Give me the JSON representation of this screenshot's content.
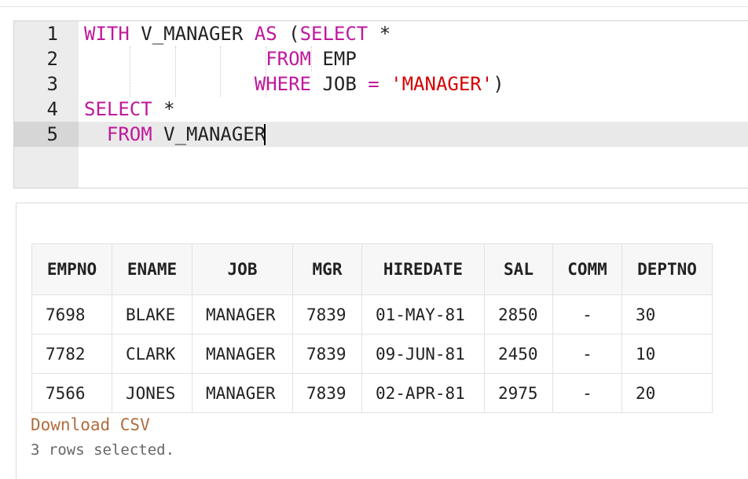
{
  "editor": {
    "line_numbers": [
      "1",
      "2",
      "3",
      "4",
      "5"
    ],
    "lines": [
      [
        {
          "t": "WITH",
          "c": "kw"
        },
        {
          "t": " V_MANAGER ",
          "c": ""
        },
        {
          "t": "AS",
          "c": "kw"
        },
        {
          "t": " (",
          "c": ""
        },
        {
          "t": "SELECT",
          "c": "kw"
        },
        {
          "t": " *",
          "c": ""
        }
      ],
      [
        {
          "t": "                ",
          "c": ""
        },
        {
          "t": "FROM",
          "c": "kw"
        },
        {
          "t": " EMP",
          "c": ""
        }
      ],
      [
        {
          "t": "               ",
          "c": ""
        },
        {
          "t": "WHERE",
          "c": "kw"
        },
        {
          "t": " JOB ",
          "c": ""
        },
        {
          "t": "=",
          "c": "op"
        },
        {
          "t": " ",
          "c": ""
        },
        {
          "t": "'MANAGER'",
          "c": "str"
        },
        {
          "t": ")",
          "c": ""
        }
      ],
      [
        {
          "t": "SELECT",
          "c": "kw"
        },
        {
          "t": " *",
          "c": ""
        }
      ],
      [
        {
          "t": "  ",
          "c": ""
        },
        {
          "t": "FROM",
          "c": "kw"
        },
        {
          "t": " V_MANAGER",
          "c": ""
        }
      ]
    ],
    "active_line": 5
  },
  "results": {
    "columns": [
      "EMPNO",
      "ENAME",
      "JOB",
      "MGR",
      "HIREDATE",
      "SAL",
      "COMM",
      "DEPTNO"
    ],
    "rows": [
      [
        "7698",
        "BLAKE",
        "MANAGER",
        "7839",
        "01-MAY-81",
        "2850",
        "-",
        "30"
      ],
      [
        "7782",
        "CLARK",
        "MANAGER",
        "7839",
        "09-JUN-81",
        "2450",
        "-",
        "10"
      ],
      [
        "7566",
        "JONES",
        "MANAGER",
        "7839",
        "02-APR-81",
        "2975",
        "-",
        "20"
      ]
    ],
    "download_label": "Download CSV",
    "row_count_text": "3 rows selected."
  },
  "colors": {
    "keyword": "#c0189c",
    "string": "#d40000",
    "link": "#b06c3c"
  }
}
